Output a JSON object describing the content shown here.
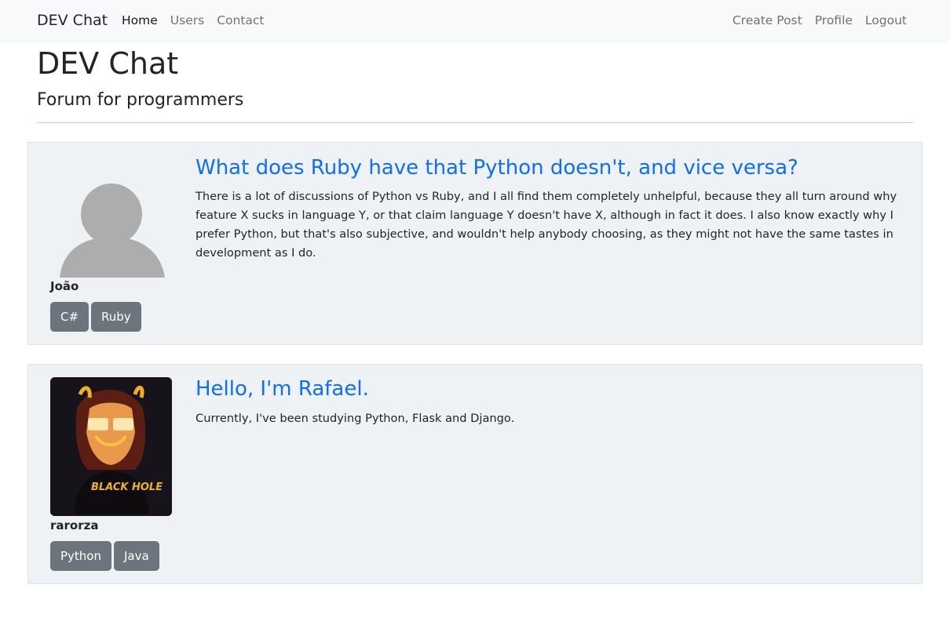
{
  "nav": {
    "brand": "DEV Chat",
    "left_links": [
      "Home",
      "Users",
      "Contact"
    ],
    "right_links": [
      "Create Post",
      "Profile",
      "Logout"
    ],
    "active": "Home"
  },
  "header": {
    "title": "DEV Chat",
    "subtitle": "Forum for programmers"
  },
  "posts": [
    {
      "title": "What does Ruby have that Python doesn't, and vice versa?",
      "body": "There is a lot of discussions of Python vs Ruby, and I all find them completely unhelpful, because they all turn around why feature X sucks in language Y, or that claim language Y doesn't have X, although in fact it does. I also know exactly why I prefer Python, but that's also subjective, and wouldn't help anybody choosing, as they might not have the same tastes in development as I do.",
      "author": "João",
      "avatar": "default-user-icon",
      "tags": [
        "C#",
        "Ruby"
      ]
    },
    {
      "title": "Hello, I'm Rafael.",
      "body": "Currently, I've been studying Python, Flask and Django.",
      "author": "rarorza",
      "avatar": "user-photo",
      "avatar_text": "BLACK HOLE",
      "tags": [
        "Python",
        "Java"
      ]
    }
  ],
  "colors": {
    "link": "#0d6efd",
    "tag_bg": "#6c757d",
    "card_bg": "#eff2f5",
    "navbar_bg": "#f8f9fa"
  }
}
